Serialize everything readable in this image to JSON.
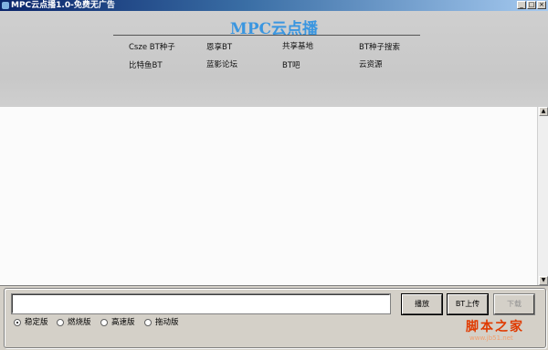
{
  "window": {
    "title": "MPC云点播1.0-免费无广告",
    "minimize_glyph": "_",
    "maximize_glyph": "□",
    "close_glyph": "×"
  },
  "header": {
    "brand": "MPC云点播",
    "links": [
      "Csze BT种子",
      "恩享BT",
      "共享基地",
      "BT种子搜索",
      "比特鱼BT",
      "蓝影论坛",
      "BT吧",
      "云资源"
    ]
  },
  "controls": {
    "url_value": "",
    "play_label": "播放",
    "upload_label": "BT上传",
    "download_label": "下载"
  },
  "versions": {
    "options": [
      "稳定版",
      "燃烧版",
      "高速版",
      "拖动版"
    ],
    "selected": 0
  },
  "watermark": {
    "text": "脚本之家",
    "url": "www.jb51.net"
  },
  "colors": {
    "brand": "#3a96e0",
    "titlebar": "#0a246a",
    "watermark": "#e03a00"
  }
}
